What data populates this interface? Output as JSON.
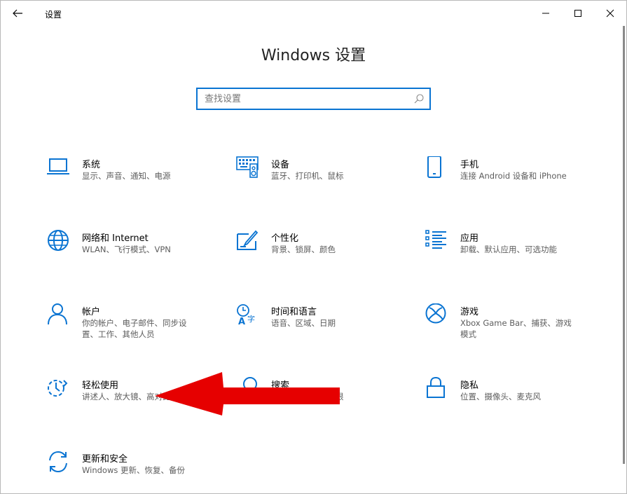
{
  "titlebar": {
    "app_title": "设置",
    "controls": [
      "minimize",
      "maximize",
      "close"
    ]
  },
  "page": {
    "title": "Windows 设置"
  },
  "search": {
    "placeholder": "查找设置",
    "value": ""
  },
  "tiles": [
    {
      "title": "系统",
      "desc": "显示、声音、通知、电源",
      "icon": "laptop-icon"
    },
    {
      "title": "设备",
      "desc": "蓝牙、打印机、鼠标",
      "icon": "keyboard-device-icon"
    },
    {
      "title": "手机",
      "desc": "连接 Android 设备和 iPhone",
      "icon": "phone-icon"
    },
    {
      "title": "网络和 Internet",
      "desc": "WLAN、飞行模式、VPN",
      "icon": "globe-icon"
    },
    {
      "title": "个性化",
      "desc": "背景、锁屏、颜色",
      "icon": "paint-icon"
    },
    {
      "title": "应用",
      "desc": "卸载、默认应用、可选功能",
      "icon": "app-list-icon"
    },
    {
      "title": "帐户",
      "desc": "你的帐户、电子邮件、同步设置、工作、其他人员",
      "icon": "person-icon"
    },
    {
      "title": "时间和语言",
      "desc": "语音、区域、日期",
      "icon": "time-language-icon"
    },
    {
      "title": "游戏",
      "desc": "Xbox Game Bar、捕获、游戏模式",
      "icon": "xbox-icon"
    },
    {
      "title": "轻松使用",
      "desc": "讲述人、放大镜、高对比度",
      "icon": "ease-of-access-icon"
    },
    {
      "title": "搜索",
      "desc": "查找我的文件、权限",
      "icon": "search-icon"
    },
    {
      "title": "隐私",
      "desc": "位置、摄像头、麦克风",
      "icon": "lock-icon"
    },
    {
      "title": "更新和安全",
      "desc": "Windows 更新、恢复、备份",
      "icon": "sync-icon"
    }
  ],
  "colors": {
    "accent": "#0a74d2",
    "annotation_arrow": "#e60000"
  }
}
